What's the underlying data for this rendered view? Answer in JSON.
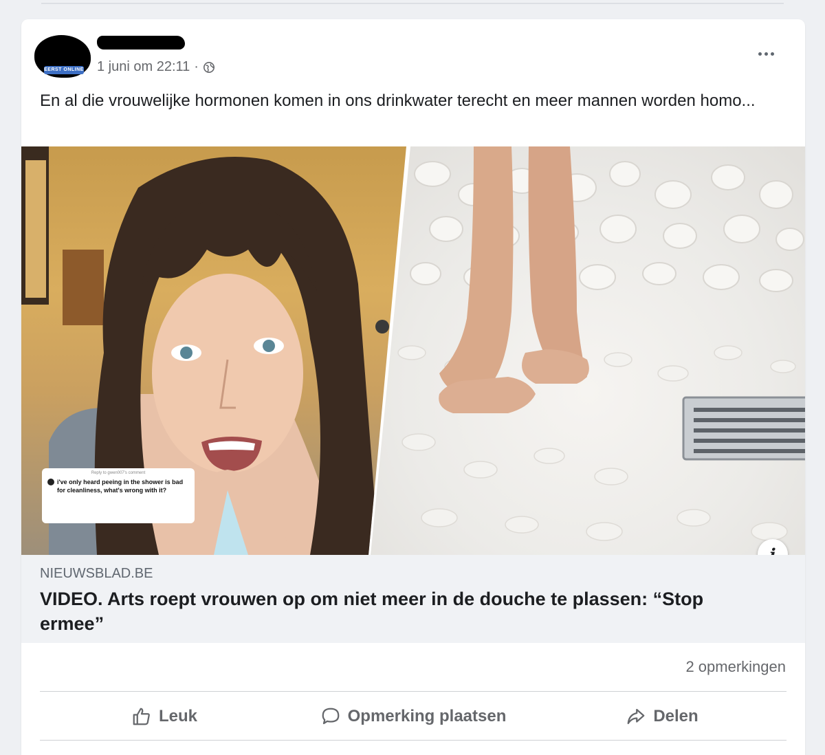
{
  "post": {
    "avatar_badge": "EERST ONLINE",
    "timestamp": "1 juni om 22:11",
    "timestamp_separator": "·",
    "audience_icon": "globe-icon",
    "more_icon": "more-options-icon",
    "text": "En al die vrouwelijke hormonen komen in ons drinkwater terecht en meer mannen worden homo..."
  },
  "link": {
    "domain": "NIEUWSBLAD.BE",
    "title": "VIDEO. Arts roept vrouwen op om niet meer in de douche te plassen: “Stop ermee”",
    "thumbnail_caption": {
      "reply_label": "Reply to gwen007's comment",
      "comment": "i've only heard peeing in the shower is bad for cleanliness, what's wrong with it?"
    },
    "info_icon": "info-icon"
  },
  "stats": {
    "comments": "2 opmerkingen"
  },
  "actions": [
    {
      "label": "Leuk",
      "icon": "thumbs-up-icon"
    },
    {
      "label": "Opmerking plaatsen",
      "icon": "comment-icon"
    },
    {
      "label": "Delen",
      "icon": "share-icon"
    }
  ],
  "colors": {
    "card_bg": "#ffffff",
    "page_bg": "#eef0f3",
    "meta_bg": "#f0f2f5",
    "secondary_text": "#65676b"
  }
}
